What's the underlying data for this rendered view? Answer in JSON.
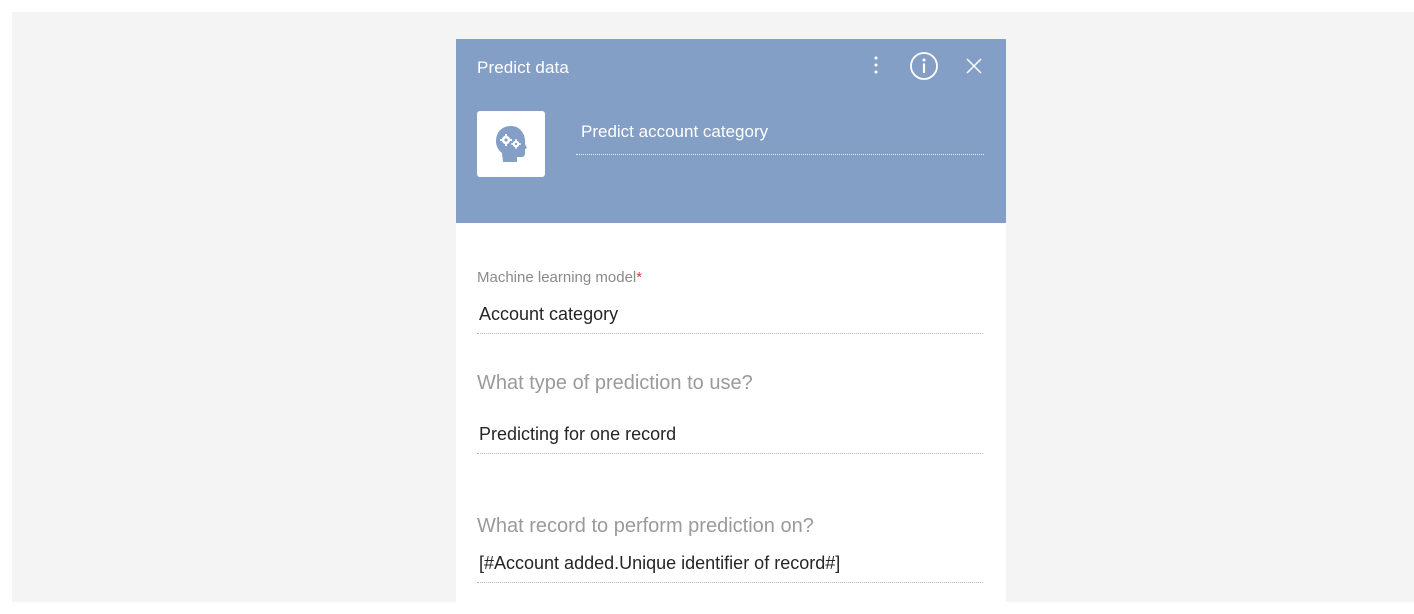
{
  "header": {
    "title": "Predict data",
    "element_name": "Predict account category"
  },
  "icons": {
    "menu": "vertical-dots-icon",
    "info": "info-circle-icon",
    "close": "close-icon",
    "app": "head-gears-icon"
  },
  "fields": {
    "model": {
      "label": "Machine learning model",
      "required_mark": "*",
      "value": "Account category"
    },
    "prediction_type": {
      "label": "What type of prediction to use?",
      "value": "Predicting for one record"
    },
    "record": {
      "label": "What record to perform prediction on?",
      "value": "[#Account added.Unique identifier of record#]"
    }
  },
  "colors": {
    "header_bg": "#839fc5",
    "page_bg": "#f4f4f4",
    "required": "#e4393c"
  }
}
